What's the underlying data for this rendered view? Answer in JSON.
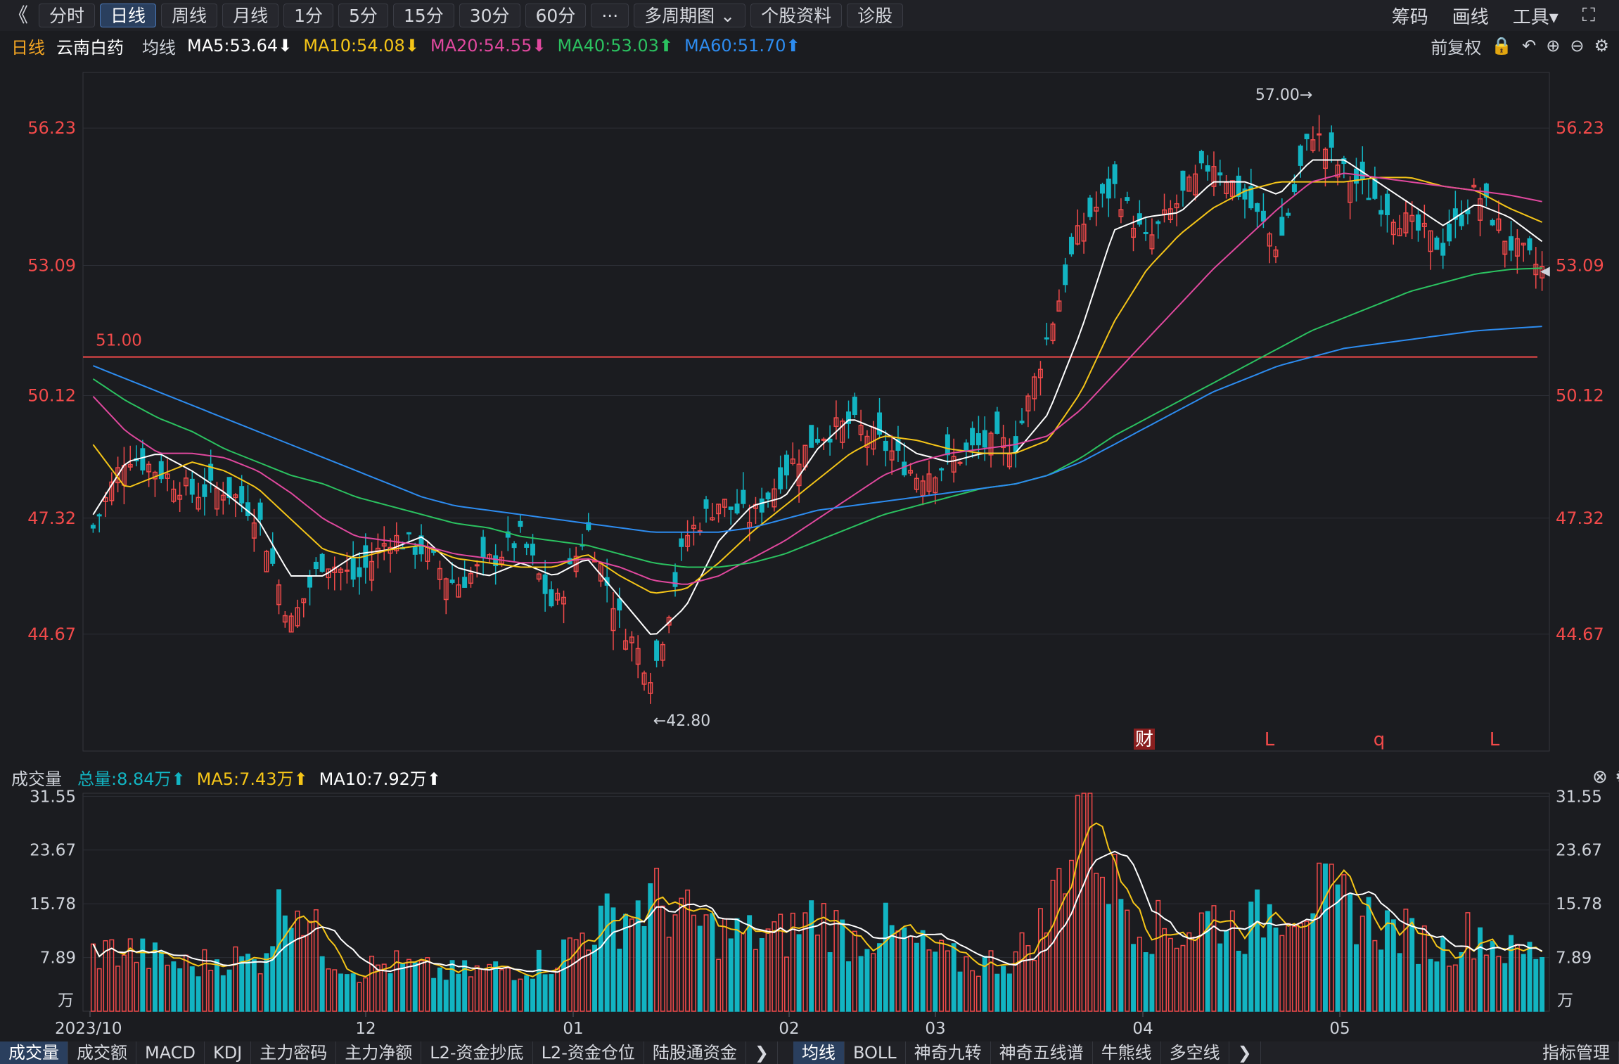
{
  "toolbar": {
    "back_icon": "double-chevron-left-icon",
    "buttons": [
      "分时",
      "日线",
      "周线",
      "月线",
      "1分",
      "5分",
      "15分",
      "30分",
      "60分",
      "···",
      "多周期图 ⌄",
      "个股资料",
      "诊股"
    ],
    "active_index": 1,
    "right": [
      "筹码",
      "画线",
      "工具▾",
      "⛶"
    ]
  },
  "info": {
    "period": "日线",
    "stock_name": "云南白药",
    "avg_label": "均线",
    "ma5": "MA5:53.64⬇",
    "ma10": "MA10:54.08⬇",
    "ma20": "MA20:54.55⬇",
    "ma40": "MA40:53.03⬆",
    "ma60": "MA60:51.70⬆",
    "adjust": "前复权",
    "icons": [
      "lock-icon",
      "undo-icon",
      "zoom-in-icon",
      "zoom-out-icon",
      "gear-icon"
    ]
  },
  "colors": {
    "up": "#f24a4a",
    "down": "#12b4c2",
    "ma5": "#ffffff",
    "ma10": "#f5c518",
    "ma20": "#e0489e",
    "ma40": "#2bc260",
    "ma60": "#2d8cf0",
    "ref": "#f24a4a",
    "grid": "#2c2e35"
  },
  "annotations": {
    "high": "57.00→",
    "low": "←42.80",
    "ref_line": "51.00"
  },
  "markers": [
    "财",
    "L",
    "q",
    "L"
  ],
  "volume": {
    "title": "成交量",
    "total": "总量:8.84万⬆",
    "ma5": "MA5:7.43万⬆",
    "ma10": "MA10:7.92万⬆",
    "unit": "万",
    "close_icon": "close-circle-icon",
    "settings_icon": "gear-icon"
  },
  "bottom_tabs_left": [
    "成交量",
    "成交额",
    "MACD",
    "KDJ",
    "主力密码",
    "主力净额",
    "L2-资金抄底",
    "L2-资金仓位",
    "陆股通资金"
  ],
  "bottom_tabs_right": [
    "均线",
    "BOLL",
    "神奇九转",
    "神奇五线谱",
    "牛熊线",
    "多空线"
  ],
  "bottom_right_label": "指标管理",
  "chart_data": {
    "type": "candlestick",
    "symbol": "云南白药",
    "yticks": [
      56.23,
      53.09,
      50.12,
      47.32,
      44.67
    ],
    "ylim": [
      42.0,
      57.5
    ],
    "xticks": [
      "2023/10",
      "12",
      "01",
      "02",
      "03",
      "04",
      "05"
    ],
    "ref_price": 51.0,
    "high": 57.0,
    "low": 42.8,
    "vol_yticks": [
      31.55,
      23.67,
      15.78,
      7.89
    ],
    "vol_ylim": [
      0,
      32
    ],
    "ohlc_anchor": [
      [
        47.3,
        47.1,
        47.6,
        46.9
      ],
      [
        48.7,
        48.8,
        49.6,
        48.3
      ],
      [
        48.6,
        48.4,
        49.3,
        48.0
      ],
      [
        48.0,
        47.9,
        48.5,
        47.5
      ],
      [
        47.6,
        48.0,
        48.5,
        47.2
      ],
      [
        46.9,
        47.4,
        47.7,
        46.5
      ],
      [
        46.8,
        44.9,
        46.9,
        44.3
      ],
      [
        45.4,
        46.4,
        46.9,
        45.2
      ],
      [
        46.3,
        45.9,
        46.6,
        45.5
      ],
      [
        46.6,
        46.9,
        47.3,
        46.3
      ],
      [
        47.2,
        46.6,
        47.4,
        46.3
      ],
      [
        46.2,
        45.8,
        46.6,
        45.5
      ],
      [
        45.5,
        46.3,
        46.7,
        45.3
      ],
      [
        46.3,
        46.9,
        47.2,
        45.9
      ],
      [
        46.0,
        45.2,
        46.3,
        44.9
      ],
      [
        46.4,
        47.1,
        47.6,
        46.1
      ],
      [
        46.6,
        45.0,
        46.6,
        43.7
      ],
      [
        44.6,
        43.7,
        44.9,
        42.8
      ],
      [
        44.5,
        46.9,
        47.4,
        44.2
      ],
      [
        47.4,
        47.7,
        48.4,
        47.2
      ],
      [
        47.6,
        47.3,
        47.9,
        46.9
      ],
      [
        47.4,
        48.4,
        48.7,
        47.1
      ],
      [
        49.0,
        49.2,
        49.7,
        48.8
      ],
      [
        49.9,
        49.5,
        50.3,
        49.3
      ],
      [
        49.4,
        49.0,
        49.8,
        48.7
      ],
      [
        48.7,
        48.3,
        49.1,
        48.0
      ],
      [
        48.9,
        48.6,
        49.6,
        48.2
      ],
      [
        49.4,
        49.0,
        49.7,
        48.8
      ],
      [
        48.9,
        49.0,
        49.8,
        48.5
      ],
      [
        49.4,
        51.5,
        52.6,
        49.2
      ],
      [
        52.5,
        54.0,
        55.6,
        52.2
      ],
      [
        54.6,
        54.9,
        55.6,
        54.1
      ],
      [
        54.2,
        53.6,
        54.6,
        53.2
      ],
      [
        53.8,
        54.6,
        55.6,
        53.6
      ],
      [
        55.3,
        55.5,
        56.0,
        54.9
      ],
      [
        55.0,
        54.6,
        55.4,
        54.3
      ],
      [
        54.7,
        53.5,
        54.9,
        53.2
      ],
      [
        53.3,
        56.2,
        57.0,
        53.1
      ],
      [
        55.9,
        55.2,
        56.1,
        54.8
      ],
      [
        55.2,
        54.6,
        55.7,
        54.1
      ],
      [
        54.8,
        54.0,
        55.8,
        53.6
      ],
      [
        53.9,
        53.5,
        54.1,
        53.2
      ],
      [
        53.4,
        54.8,
        55.2,
        52.7
      ],
      [
        54.1,
        53.6,
        54.2,
        53.3
      ],
      [
        53.6,
        53.0,
        53.7,
        52.7
      ]
    ],
    "vol_anchor": [
      8.5,
      9.0,
      7.5,
      6.5,
      8.0,
      7.0,
      18.5,
      9.0,
      6.0,
      7.0,
      6.0,
      5.5,
      6.0,
      6.5,
      7.5,
      12.0,
      14.0,
      16.5,
      13.5,
      11.5,
      11.0,
      11.0,
      14.5,
      10.5,
      12.0,
      9.5,
      7.5,
      7.0,
      8.0,
      13.5,
      32.0,
      18.5,
      12.5,
      11.5,
      14.0,
      12.0,
      16.0,
      17.0,
      15.5,
      13.0,
      11.0,
      9.0,
      12.0,
      8.5,
      8.84
    ],
    "ma_series": [
      {
        "name": "MA5",
        "values": [
          47.4,
          48.6,
          48.8,
          48.4,
          47.9,
          47.3,
          46.0,
          46.0,
          46.5,
          46.6,
          46.9,
          46.2,
          46.0,
          46.3,
          46.0,
          46.4,
          45.5,
          44.6,
          45.3,
          46.8,
          47.6,
          47.8,
          48.9,
          49.6,
          49.3,
          48.8,
          48.6,
          48.8,
          48.8,
          49.7,
          51.6,
          53.9,
          54.2,
          54.3,
          55.0,
          55.0,
          54.7,
          55.5,
          55.5,
          55.0,
          54.5,
          54.0,
          54.5,
          54.2,
          53.64
        ]
      },
      {
        "name": "MA10",
        "values": [
          49.0,
          48.0,
          48.3,
          48.6,
          48.4,
          48.0,
          47.3,
          46.6,
          46.4,
          46.6,
          46.7,
          46.4,
          46.3,
          46.2,
          46.2,
          46.5,
          46.0,
          45.6,
          45.7,
          46.3,
          47.0,
          47.6,
          48.2,
          48.8,
          49.2,
          49.1,
          48.9,
          48.8,
          48.8,
          49.1,
          50.2,
          51.8,
          53.0,
          53.8,
          54.4,
          54.8,
          55.0,
          55.0,
          55.0,
          55.1,
          55.1,
          54.9,
          54.8,
          54.4,
          54.08
        ]
      },
      {
        "name": "MA20",
        "values": [
          50.1,
          49.3,
          48.8,
          48.8,
          48.7,
          48.4,
          47.9,
          47.3,
          46.9,
          46.8,
          46.7,
          46.5,
          46.4,
          46.3,
          46.3,
          46.4,
          46.2,
          45.9,
          45.8,
          46.0,
          46.4,
          46.8,
          47.3,
          47.8,
          48.3,
          48.6,
          48.8,
          48.9,
          49.0,
          49.2,
          49.8,
          50.6,
          51.4,
          52.2,
          53.0,
          53.7,
          54.4,
          55.0,
          55.2,
          55.1,
          55.0,
          54.9,
          54.8,
          54.7,
          54.55
        ]
      },
      {
        "name": "MA40",
        "values": [
          50.5,
          50.0,
          49.6,
          49.3,
          48.9,
          48.6,
          48.3,
          48.1,
          47.8,
          47.6,
          47.4,
          47.2,
          47.1,
          46.9,
          46.8,
          46.7,
          46.5,
          46.3,
          46.2,
          46.2,
          46.3,
          46.5,
          46.8,
          47.1,
          47.4,
          47.6,
          47.8,
          48.0,
          48.1,
          48.3,
          48.7,
          49.2,
          49.6,
          50.0,
          50.4,
          50.8,
          51.2,
          51.6,
          51.9,
          52.2,
          52.5,
          52.7,
          52.9,
          53.0,
          53.03
        ]
      },
      {
        "name": "MA60",
        "values": [
          50.8,
          50.5,
          50.2,
          49.9,
          49.6,
          49.3,
          49.0,
          48.7,
          48.4,
          48.1,
          47.8,
          47.6,
          47.5,
          47.4,
          47.3,
          47.2,
          47.1,
          47.0,
          47.0,
          47.0,
          47.1,
          47.3,
          47.5,
          47.6,
          47.7,
          47.8,
          47.9,
          48.0,
          48.1,
          48.3,
          48.6,
          49.0,
          49.4,
          49.8,
          50.2,
          50.5,
          50.8,
          51.0,
          51.2,
          51.3,
          51.4,
          51.5,
          51.6,
          51.65,
          51.7
        ]
      }
    ]
  }
}
